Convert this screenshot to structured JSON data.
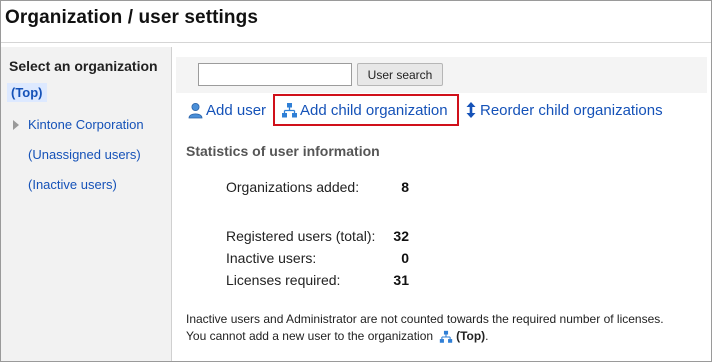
{
  "title": "Organization / user settings",
  "sidebar": {
    "heading": "Select an organization",
    "items": [
      {
        "label": "(Top)"
      },
      {
        "label": "Kintone Corporation"
      },
      {
        "label": "(Unassigned users)"
      },
      {
        "label": "(Inactive users)"
      }
    ]
  },
  "search": {
    "input_value": "",
    "button_label": "User search"
  },
  "actions": {
    "add_user": "Add user",
    "add_child": "Add child organization",
    "reorder": "Reorder child organizations"
  },
  "stats": {
    "title": "Statistics of user information",
    "organizations_added_label": "Organizations added:",
    "organizations_added_value": "8",
    "registered_label": "Registered users (total):",
    "registered_value": "32",
    "inactive_label": "Inactive users:",
    "inactive_value": "0",
    "licenses_label": "Licenses required:",
    "licenses_value": "31"
  },
  "notes": {
    "line1": "Inactive users and Administrator are not counted towards the required number of licenses.",
    "line2": "You cannot add a new user to the organization",
    "line2_org": "(Top)",
    "line2_end": "."
  },
  "colors": {
    "link": "#1552b8",
    "highlight_border": "#d0101a",
    "selected_bg": "#dde9ff"
  }
}
